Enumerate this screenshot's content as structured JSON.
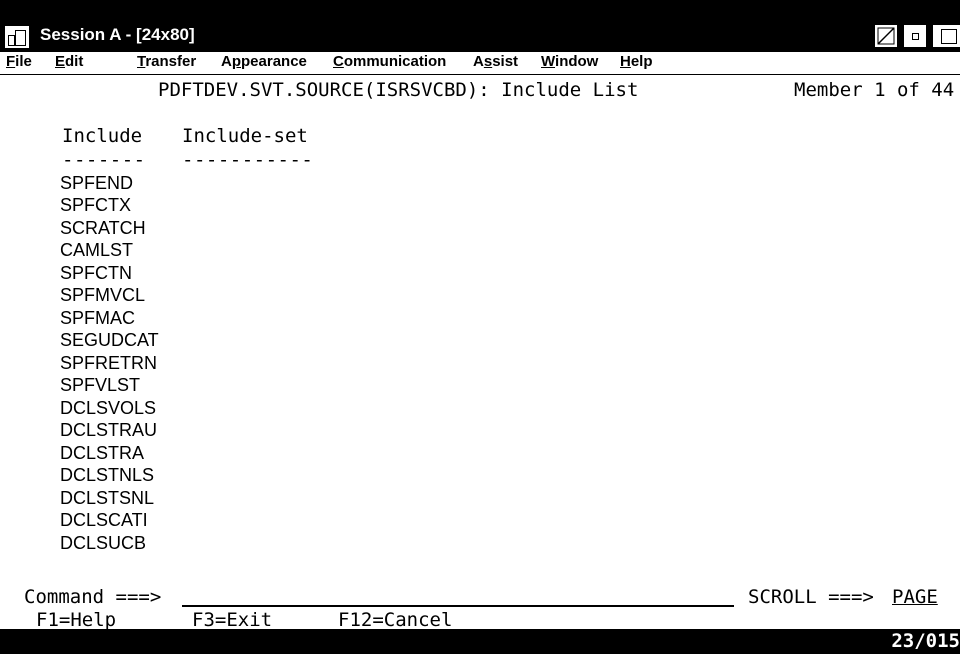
{
  "window": {
    "title": "Session A - [24x80]"
  },
  "menubar": {
    "items": [
      {
        "label": "File",
        "accel": "F"
      },
      {
        "label": "Edit",
        "accel": "E"
      },
      {
        "label": "Transfer",
        "accel": "T"
      },
      {
        "label": "Appearance",
        "accel": "p"
      },
      {
        "label": "Communication",
        "accel": "C"
      },
      {
        "label": "Assist",
        "accel": "s"
      },
      {
        "label": "Window",
        "accel": "W"
      },
      {
        "label": "Help",
        "accel": "H"
      }
    ]
  },
  "screen": {
    "header_title": "PDFTDEV.SVT.SOURCE(ISRSVCBD): Include List",
    "member_info": "Member 1 of 44",
    "col_include": "Include",
    "col_include_set": "Include-set",
    "col_include_dash": "-------",
    "col_include_set_dash": "-----------",
    "includes": [
      "SPFEND",
      "SPFCTX",
      "SCRATCH",
      "CAMLST",
      "SPFCTN",
      "SPFMVCL",
      "SPFMAC",
      "SEGUDCAT",
      "SPFRETRN",
      "SPFVLST",
      "DCLSVOLS",
      "DCLSTRAU",
      "DCLSTRA",
      "DCLSTNLS",
      "DCLSTSNL",
      "DCLSCATI",
      "DCLSUCB"
    ],
    "command_label": "Command ===>",
    "command_value": "",
    "scroll_label": "SCROLL ===>",
    "scroll_value": "PAGE",
    "fkeys": {
      "f1": "F1=Help",
      "f3": "F3=Exit",
      "f12": "F12=Cancel"
    }
  },
  "status": {
    "cursor_pos": "23/015"
  }
}
